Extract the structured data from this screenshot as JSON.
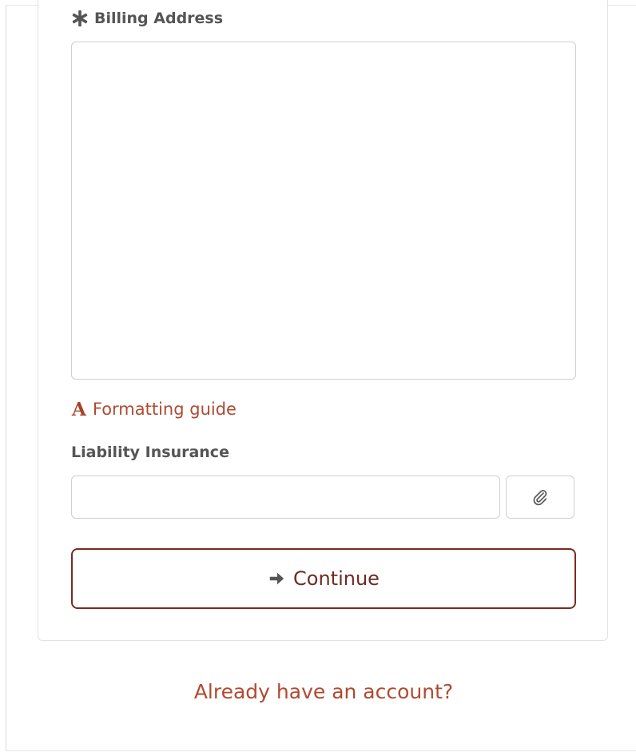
{
  "form": {
    "billing_address": {
      "label": "Billing Address",
      "required_icon": "asterisk-icon",
      "value": ""
    },
    "formatting_guide": {
      "icon": "format-a-icon",
      "label": "Formatting guide"
    },
    "liability_insurance": {
      "label": "Liability Insurance",
      "value": "",
      "attach_icon": "paperclip-icon"
    },
    "continue_button": {
      "icon": "arrow-right-icon",
      "label": "Continue"
    }
  },
  "footer": {
    "account_link": "Already have an account?"
  },
  "colors": {
    "link": "#b04a32",
    "primary_button_border": "#7a2a22",
    "text": "#555555",
    "border": "#cfcfcf"
  }
}
